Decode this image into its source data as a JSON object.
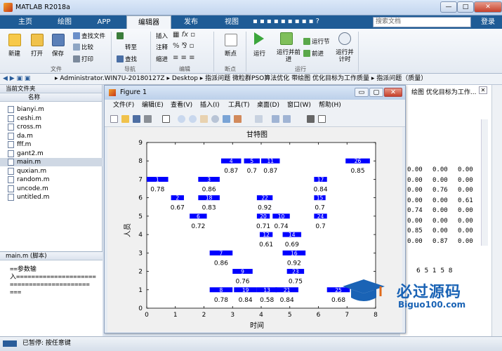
{
  "window": {
    "title": "MATLAB R2018a",
    "min": "—",
    "max": "□",
    "close": "✕"
  },
  "tabs": [
    "主页",
    "绘图",
    "APP",
    "编辑器",
    "发布",
    "视图"
  ],
  "search": {
    "placeholder": "搜索文档"
  },
  "login": "登录",
  "ribbon": {
    "file": {
      "new": "新建",
      "open": "打开",
      "save": "保存",
      "find_files": "查找文件",
      "compare": "比较",
      "print": "打印",
      "group": "文件"
    },
    "nav": {
      "goto": "转至",
      "find": "查找",
      "group": "导航"
    },
    "edit": {
      "insert": "插入",
      "comment": "注释",
      "indent": "缩进",
      "group": "编辑"
    },
    "breakpoint": {
      "label": "断点",
      "group": "断点"
    },
    "run": {
      "run": "运行",
      "run_advance": "运行并前进",
      "run_section": "运行节",
      "advance": "前进",
      "run_time": "运行并计时",
      "group": "运行"
    }
  },
  "path": "▸ Administrator.WIN7U-20180127Z ▸ Desktop ▸ 指派问题 微粒群PSO算法优化 带绘图 优化目标为工作质量 ▸ 指派问题（质量）",
  "current_folder": {
    "header": "当前文件夹",
    "col": "名称",
    "files": [
      "bianyi.m",
      "ceshi.m",
      "cross.m",
      "da.m",
      "fff.m",
      "gant2.m",
      "main.m",
      "quxian.m",
      "random.m",
      "uncode.m",
      "untitled.m"
    ],
    "selected": "main.m"
  },
  "details": {
    "header": "main.m (脚本)",
    "lines": [
      "==参数输",
      "入=====================",
      "=====================",
      "==="
    ]
  },
  "status": "已暂停: 按任意键",
  "figure": {
    "title": "Figure 1",
    "menus": [
      "文件(F)",
      "编辑(E)",
      "查看(V)",
      "插入(I)",
      "工具(T)",
      "桌面(D)",
      "窗口(W)",
      "帮助(H)"
    ],
    "controls": {
      "min": "▭",
      "max": "▢",
      "close": "✕"
    }
  },
  "chart_data": {
    "type": "gantt",
    "title": "甘特图",
    "xlabel": "时间",
    "ylabel": "人员",
    "xlim": [
      0,
      8
    ],
    "ylim": [
      0,
      9
    ],
    "xticks": [
      0,
      1,
      2,
      3,
      4,
      5,
      6,
      7,
      8
    ],
    "yticks": [
      0,
      1,
      2,
      3,
      4,
      5,
      6,
      7,
      8,
      9
    ],
    "bar_color": "#0000ff",
    "tasks": [
      {
        "id": "1",
        "row": 7,
        "start": 0,
        "end": 0.75,
        "value": "0.78"
      },
      {
        "id": "2",
        "row": 6,
        "start": 0.85,
        "end": 1.3,
        "value": "0.67"
      },
      {
        "id": "18",
        "row": 6,
        "start": 1.8,
        "end": 2.55,
        "value": "0.83"
      },
      {
        "id": "3",
        "row": 7,
        "start": 1.8,
        "end": 2.55,
        "value": "0.86"
      },
      {
        "id": "6",
        "row": 5,
        "start": 1.5,
        "end": 2.1,
        "value": "0.72"
      },
      {
        "id": "4",
        "row": 8,
        "start": 2.6,
        "end": 3.3,
        "value": "0.87"
      },
      {
        "id": "5",
        "row": 8,
        "start": 3.4,
        "end": 3.95,
        "value": "0.7"
      },
      {
        "id": "11",
        "row": 8,
        "start": 4.0,
        "end": 4.65,
        "value": "0.87"
      },
      {
        "id": "26",
        "row": 8,
        "start": 6.95,
        "end": 7.8,
        "value": "0.85"
      },
      {
        "id": "17",
        "row": 7,
        "start": 5.85,
        "end": 6.3,
        "value": "0.84"
      },
      {
        "id": "22",
        "row": 6,
        "start": 3.85,
        "end": 4.4,
        "value": "0.92"
      },
      {
        "id": "15",
        "row": 6,
        "start": 5.85,
        "end": 6.25,
        "value": "0.7"
      },
      {
        "id": "20",
        "row": 5,
        "start": 3.85,
        "end": 4.3,
        "value": "0.71"
      },
      {
        "id": "10",
        "row": 5,
        "start": 4.4,
        "end": 5.0,
        "value": "0.74"
      },
      {
        "id": "24",
        "row": 5,
        "start": 5.85,
        "end": 6.3,
        "value": "0.7"
      },
      {
        "id": "12",
        "row": 4,
        "start": 3.95,
        "end": 4.4,
        "value": "0.61"
      },
      {
        "id": "14",
        "row": 4,
        "start": 4.75,
        "end": 5.4,
        "value": "0.69"
      },
      {
        "id": "7",
        "row": 3,
        "start": 2.2,
        "end": 3.0,
        "value": "0.86"
      },
      {
        "id": "16",
        "row": 3,
        "start": 4.75,
        "end": 5.55,
        "value": "0.92"
      },
      {
        "id": "9",
        "row": 2,
        "start": 3.0,
        "end": 3.7,
        "value": "0.76"
      },
      {
        "id": "23",
        "row": 2,
        "start": 4.9,
        "end": 5.5,
        "value": "0.75"
      },
      {
        "id": "8",
        "row": 1,
        "start": 2.2,
        "end": 3.0,
        "value": "0.78"
      },
      {
        "id": "19",
        "row": 1,
        "start": 3.05,
        "end": 3.85,
        "value": "0.84"
      },
      {
        "id": "13",
        "row": 1,
        "start": 3.85,
        "end": 4.55,
        "value": "0.58"
      },
      {
        "id": "21",
        "row": 1,
        "start": 4.5,
        "end": 5.3,
        "value": "0.84"
      },
      {
        "id": "25",
        "row": 1,
        "start": 6.3,
        "end": 7.1,
        "value": "0.68"
      }
    ]
  },
  "workspace": {
    "rows": [
      [
        "0.00",
        "0.00",
        "0.00"
      ],
      [
        "0.00",
        "0.00",
        "0.00"
      ],
      [
        "0.00",
        "0.76",
        "0.00"
      ],
      [
        "0.00",
        "0.00",
        "0.61"
      ],
      [
        "0.74",
        "0.00",
        "0.00"
      ],
      [
        "0.00",
        "0.00",
        "0.00"
      ],
      [
        "0.85",
        "0.00",
        "0.00"
      ],
      [
        "0.00",
        "0.87",
        "0.00"
      ]
    ],
    "numbers": "6  5  1  5  8"
  },
  "watermark": {
    "brand": "必过源码",
    "url": "Biguo100.com",
    "colors": {
      "main": "#1a63b5",
      "accent": "#e06a1b"
    }
  }
}
